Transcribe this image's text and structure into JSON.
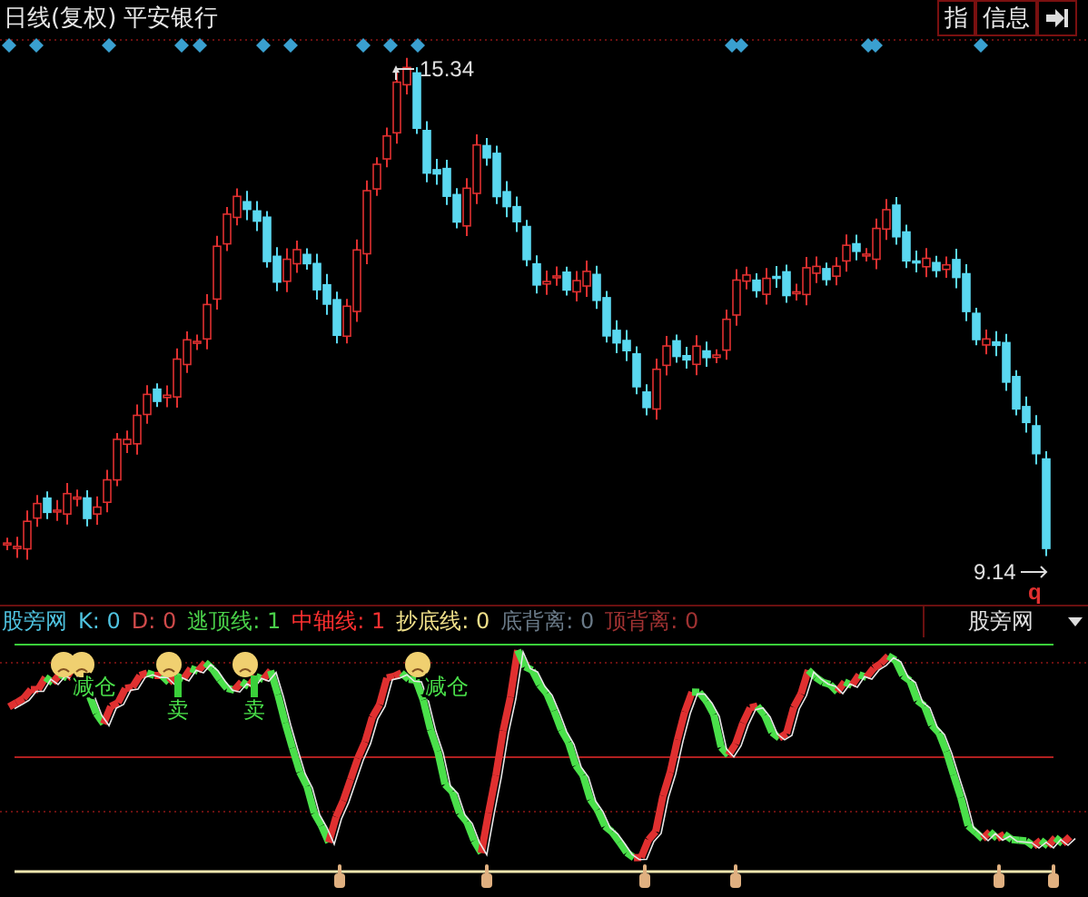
{
  "chart_header": {
    "period": "日线(复权)",
    "stock": "平安银行"
  },
  "toolbar": [
    {
      "label": "指",
      "kind": "text"
    },
    {
      "label": "信息",
      "kind": "text"
    },
    {
      "kind": "arrow"
    }
  ],
  "price_labels": {
    "high": "15.34",
    "low": "9.14",
    "marker": "q"
  },
  "indicator": {
    "name": "股旁网",
    "values": [
      {
        "label": "K: 0",
        "color": "#4fc3e0"
      },
      {
        "label": "D: 0",
        "color": "#d04a4a"
      },
      {
        "label": "逃顶线: 1",
        "color": "#4ad04a"
      },
      {
        "label": "中轴线: 1",
        "color": "#ff3030"
      },
      {
        "label": "抄底线: 0",
        "color": "#f0e08a"
      },
      {
        "label": "底背离: 0",
        "color": "#6a7a88"
      },
      {
        "label": "顶背离: 0",
        "color": "#a03232"
      }
    ]
  },
  "selector": {
    "value": "股旁网"
  },
  "signals": [
    {
      "text": "减仓",
      "kind": "reduce"
    },
    {
      "text": "卖",
      "kind": "sell"
    },
    {
      "text": "卖",
      "kind": "sell"
    },
    {
      "text": "减仓",
      "kind": "reduce"
    }
  ]
}
